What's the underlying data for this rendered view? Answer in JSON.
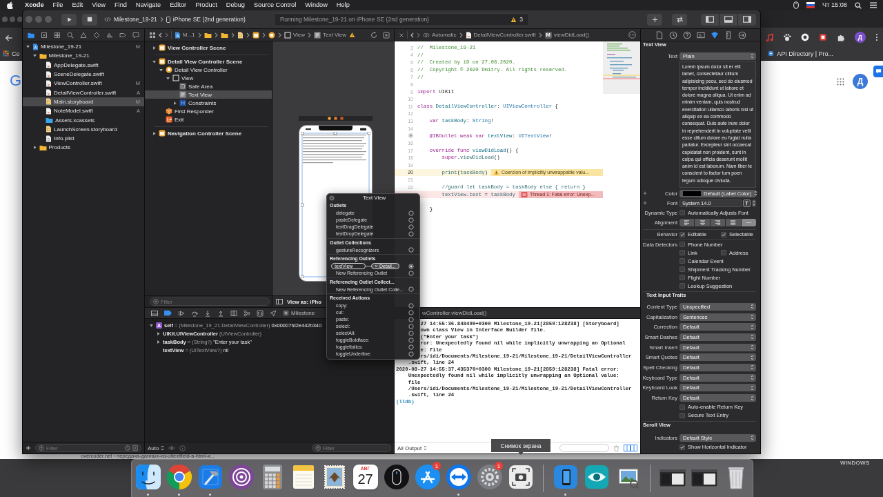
{
  "menu_bar": {
    "app": "Xcode",
    "menus": [
      "File",
      "Edit",
      "View",
      "Find",
      "Navigate",
      "Editor",
      "Product",
      "Debug",
      "Source Control",
      "Window",
      "Help"
    ],
    "clock": "Чт 15:08"
  },
  "browser": {
    "bookmark_left": "Ce",
    "bookmark": "API Directory | Pro...",
    "profile": "Д",
    "logo": "G",
    "account": "Д",
    "result_url": "overcoder.net › передача-данных-из-uitextfield-в-html-и..."
  },
  "desktop_label": "WINDOWS",
  "toolbar": {
    "scheme": "Milestone_19-21",
    "destination": "iPhone SE (2nd generation)",
    "activity": "Running Milestone_19-21 on iPhone SE (2nd generation)",
    "warning_count": "3"
  },
  "navigator": {
    "tabs": [
      {
        "kind": "project",
        "selected": true
      },
      {
        "kind": "source_control",
        "selected": false
      },
      {
        "kind": "symbols",
        "selected": false
      },
      {
        "kind": "find",
        "selected": false
      },
      {
        "kind": "issues",
        "selected": false
      },
      {
        "kind": "tests",
        "selected": false
      },
      {
        "kind": "debug",
        "selected": false
      },
      {
        "kind": "breakpoints",
        "selected": false
      },
      {
        "kind": "reports",
        "selected": false
      }
    ],
    "tree": [
      {
        "name": "Milestone_19-21",
        "kind": "project",
        "status": "M",
        "expanded": true,
        "selected": false,
        "children": [
          {
            "name": "Milestone_19-21",
            "kind": "folder",
            "expanded": true,
            "selected": false,
            "children": [
              {
                "name": "AppDelegate.swift",
                "kind": "swift",
                "selected": false
              },
              {
                "name": "SceneDelegate.swift",
                "kind": "swift",
                "selected": false
              },
              {
                "name": "ViewController.swift",
                "kind": "swift",
                "status": "M",
                "selected": false
              },
              {
                "name": "DetailViewController.swift",
                "kind": "swift",
                "status": "A",
                "selected": false
              },
              {
                "name": "Main.storyboard",
                "kind": "storyboard",
                "status": "M",
                "selected": true
              },
              {
                "name": "NoteModel.swift",
                "kind": "swift",
                "status": "A",
                "selected": false
              },
              {
                "name": "Assets.xcassets",
                "kind": "assets",
                "selected": false
              },
              {
                "name": "LaunchScreen.storyboard",
                "kind": "storyboard",
                "selected": false
              },
              {
                "name": "Info.plist",
                "kind": "plist",
                "selected": false
              }
            ]
          },
          {
            "name": "Products",
            "kind": "folder",
            "expanded": false,
            "selected": false
          }
        ]
      }
    ],
    "filter_placeholder": "Filter"
  },
  "storyboard_path": [
    "M...1",
    "View",
    "Text View"
  ],
  "outline": {
    "tree": [
      {
        "name": "View Controller Scene",
        "kind": "scene",
        "expanded": false,
        "selected": false
      },
      {
        "name": "Detail View Controller Scene",
        "kind": "scene",
        "expanded": true,
        "selected": false,
        "children": [
          {
            "name": "Detail View Controller",
            "kind": "controller",
            "expanded": true,
            "selected": false,
            "children": [
              {
                "name": "View",
                "kind": "view",
                "expanded": true,
                "selected": false,
                "children": [
                  {
                    "name": "Safe Area",
                    "kind": "safe_area",
                    "selected": false
                  },
                  {
                    "name": "Text View",
                    "kind": "text_view",
                    "selected": true
                  },
                  {
                    "name": "Constraints",
                    "kind": "constraints",
                    "expanded": false,
                    "selected": false
                  }
                ]
              }
            ]
          },
          {
            "name": "First Responder",
            "kind": "responder",
            "selected": false
          },
          {
            "name": "Exit",
            "kind": "exit",
            "selected": false
          }
        ]
      },
      {
        "name": "Navigation Controller Scene",
        "kind": "scene",
        "expanded": false,
        "selected": false
      }
    ],
    "filter_placeholder": "Filter"
  },
  "canvas": {
    "view_as": "View as: iPho"
  },
  "editor": {
    "jump_bar": {
      "mode": "Automatic",
      "file": "DetailViewController.swift",
      "symbol_badge": "M",
      "symbol": "viewDidLoad()"
    },
    "lines": [
      {
        "number": "3",
        "kind": "plain",
        "tokens": [
          {
            "kind": "comment",
            "text": "//  Milestone_19-21"
          }
        ]
      },
      {
        "number": "4",
        "kind": "plain",
        "tokens": [
          {
            "kind": "comment",
            "text": "//"
          }
        ]
      },
      {
        "number": "5",
        "kind": "plain",
        "tokens": [
          {
            "kind": "comment",
            "text": "//  Created by iD on 27.08.2020."
          }
        ]
      },
      {
        "number": "6",
        "kind": "plain",
        "tokens": [
          {
            "kind": "comment",
            "text": "//  Copyright © 2020 Dmitry. All rights reserved."
          }
        ]
      },
      {
        "number": "7",
        "kind": "plain",
        "tokens": [
          {
            "kind": "comment",
            "text": "//"
          }
        ]
      },
      {
        "number": "8",
        "kind": "plain"
      },
      {
        "number": "9",
        "kind": "plain",
        "tokens": [
          {
            "kind": "keyword",
            "text": "import"
          },
          {
            "kind": "plain",
            "text": " UIKit"
          }
        ]
      },
      {
        "number": "10",
        "kind": "plain"
      },
      {
        "number": "11",
        "kind": "plain",
        "tokens": [
          {
            "kind": "keyword",
            "text": "class"
          },
          {
            "kind": "declaration",
            "text": " DetailViewController"
          },
          {
            "kind": "plain",
            "text": ": "
          },
          {
            "kind": "type",
            "text": "UIViewController"
          },
          {
            "kind": "plain",
            "text": " {"
          }
        ]
      },
      {
        "number": "12",
        "kind": "plain"
      },
      {
        "number": "13",
        "kind": "plain",
        "tokens": [
          {
            "kind": "keyword",
            "text": "    var"
          },
          {
            "kind": "declaration",
            "text": " taskBody"
          },
          {
            "kind": "plain",
            "text": ": "
          },
          {
            "kind": "type",
            "text": "String"
          },
          {
            "kind": "plain",
            "text": "!"
          }
        ]
      },
      {
        "number": "14",
        "kind": "plain"
      },
      {
        "kind": "outlet",
        "tokens": [
          {
            "kind": "keyword",
            "text": "    @IBOutlet weak var"
          },
          {
            "kind": "declaration",
            "text": " textView"
          },
          {
            "kind": "plain",
            "text": ": "
          },
          {
            "kind": "type",
            "text": "UITextView"
          },
          {
            "kind": "plain",
            "text": "!"
          }
        ]
      },
      {
        "number": "16",
        "kind": "plain"
      },
      {
        "number": "17",
        "kind": "plain",
        "tokens": [
          {
            "kind": "keyword",
            "text": "    override func"
          },
          {
            "kind": "declaration",
            "text": " viewDidLoad"
          },
          {
            "kind": "plain",
            "text": "() {"
          }
        ]
      },
      {
        "number": "18",
        "kind": "plain",
        "tokens": [
          {
            "kind": "keyword",
            "text": "        super"
          },
          {
            "kind": "plain",
            "text": "."
          },
          {
            "kind": "call",
            "text": "viewDidLoad"
          },
          {
            "kind": "plain",
            "text": "()"
          }
        ]
      },
      {
        "number": "19",
        "kind": "plain"
      },
      {
        "number": "20",
        "kind": "warning",
        "tokens": [
          {
            "kind": "call",
            "text": "        print"
          },
          {
            "kind": "plain",
            "text": "("
          },
          {
            "kind": "call",
            "text": "taskBody"
          },
          {
            "kind": "plain",
            "text": ")"
          }
        ],
        "issue": "Coercion of implicitly unwrappable valu..."
      },
      {
        "number": "21",
        "kind": "plain"
      },
      {
        "number": "22",
        "kind": "plain",
        "tokens": [
          {
            "kind": "call",
            "text": "        //guard let taskBody = taskBody else { return }"
          }
        ]
      },
      {
        "kind": "error",
        "tokens": [
          {
            "kind": "call",
            "text": "        textView"
          },
          {
            "kind": "plain",
            "text": "."
          },
          {
            "kind": "call",
            "text": "text"
          },
          {
            "kind": "plain",
            "text": " = "
          },
          {
            "kind": "call",
            "text": "taskBody"
          }
        ],
        "issue": "Thread 1: Fatal error: Unexp..."
      },
      {
        "kind": "plain"
      },
      {
        "kind": "plain",
        "tokens": [
          {
            "kind": "plain",
            "text": "    }"
          }
        ]
      }
    ]
  },
  "connections": {
    "title": "Text View",
    "sections": [
      {
        "title": "Outlets",
        "rows": [
          {
            "kind": "slot",
            "name": "delegate",
            "connected": false
          },
          {
            "kind": "slot",
            "name": "pasteDelegate",
            "connected": false
          },
          {
            "kind": "slot",
            "name": "textDragDelegate",
            "connected": false
          },
          {
            "kind": "slot",
            "name": "textDropDelegate",
            "connected": false
          }
        ]
      },
      {
        "title": "Outlet Collections",
        "rows": [
          {
            "kind": "slot",
            "name": "gestureRecognizers",
            "connected": false
          }
        ]
      },
      {
        "title": "Referencing Outlets",
        "rows": [
          {
            "kind": "link",
            "name": "textView",
            "target": "Detail...",
            "connected": true
          },
          {
            "kind": "slot",
            "name": "New Referencing Outlet",
            "connected": false
          }
        ]
      },
      {
        "title": "Referencing Outlet Collect...",
        "rows": [
          {
            "kind": "slot",
            "name": "New Referencing Outlet Colle...",
            "connected": false
          }
        ]
      },
      {
        "title": "Received Actions",
        "rows": [
          {
            "kind": "slot",
            "name": "copy:",
            "connected": false
          },
          {
            "kind": "slot",
            "name": "cut:",
            "connected": false
          },
          {
            "kind": "slot",
            "name": "paste:",
            "connected": false
          },
          {
            "kind": "slot",
            "name": "select:",
            "connected": false
          },
          {
            "kind": "slot",
            "name": "selectAll:",
            "connected": false
          },
          {
            "kind": "slot",
            "name": "toggleBoldface:",
            "connected": false
          },
          {
            "kind": "slot",
            "name": "toggleItalics:",
            "connected": false
          },
          {
            "kind": "slot",
            "name": "toggleUnderline:",
            "connected": false
          }
        ]
      }
    ]
  },
  "debug_bar": {
    "breakpoints_on": true,
    "process": "Milestone",
    "frame": "wController.viewDidLoad()"
  },
  "variables": [
    {
      "badge": "A",
      "name": "self",
      "type": "= (Milestone_19_21.DetailViewController)",
      "value": "0x00007fd2e442b340",
      "expanded": true,
      "children": [
        {
          "name": "UIKit.UIViewController",
          "type": "(UIViewController)",
          "expanded": false
        },
        {
          "name": "taskBody",
          "type": "= (String?)",
          "value": "\"Enter your task\"",
          "expanded": false
        },
        {
          "name": "textView",
          "type": "= (UITextView?)",
          "value": "nil"
        }
      ]
    }
  ],
  "variables_footer": {
    "scope": "Auto",
    "filter_placeholder": "Filter"
  },
  "console": [
    {
      "kind": "clipped",
      "text": "27 14:55:36.848499+0300 Milestone_19-21[2859:128238] [Storyboard]"
    },
    {
      "kind": "clipped",
      "text": "own class View in Interface Builder file."
    },
    {
      "kind": "clipped",
      "text": "(\"Enter your task\")"
    },
    {
      "kind": "clipped",
      "text": "ror: Unexpectedly found nil while implicitly unwrapping an Optional"
    },
    {
      "kind": "clipped",
      "text": "e: file"
    },
    {
      "kind": "clipped",
      "text": "rs/idi/Documents/Milestone_19-21/Milestone_19-21/DetailViewController"
    },
    {
      "kind": "output",
      "text": "    .swift, line 24"
    },
    {
      "kind": "output",
      "text": "2020-08-27 14:55:37.435370+0300 Milestone_19-21[2859:128238] Fatal error:"
    },
    {
      "kind": "output",
      "text": "    Unexpectedly found nil while implicitly unwrapping an Optional value:"
    },
    {
      "kind": "output",
      "text": "    file"
    },
    {
      "kind": "output",
      "text": "    /Users/idi/Documents/Milestone_19-21/Milestone_19-21/DetailViewController"
    },
    {
      "kind": "output",
      "text": "    .swift, line 24"
    },
    {
      "kind": "prompt",
      "text": "(lldb)"
    }
  ],
  "console_footer": {
    "output": "All Output"
  },
  "inspector": {
    "tabs": [
      {
        "kind": "file",
        "selected": false
      },
      {
        "kind": "history",
        "selected": false
      },
      {
        "kind": "help",
        "selected": false
      },
      {
        "kind": "identity",
        "selected": false
      },
      {
        "kind": "attributes",
        "selected": true
      },
      {
        "kind": "size",
        "selected": false
      },
      {
        "kind": "connections",
        "selected": false
      }
    ],
    "title": "Text View",
    "text_type": {
      "label": "Text",
      "value": "Plain"
    },
    "text": "Lorem ipsum dolor sit er elit lamet, consectetaur cillium adipisicing pecu, sed do eiusmod tempor incididunt ut labore et dolore magna aliqua. Ut enim ad minim veniam, quis nostrud exercitation ullamco laboris nisi ut aliquip ex ea commodo consequat. Duis aute irure dolor in reprehenderit in voluptate velit esse cillum dolore eu fugiat nulla pariatur. Excepteur sint occaecat cupidatat non proident, sunt in culpa qui officia deserunt mollit anim id est laborum. Nam liber te conscient to factor tum poen legum odioque civiuda.",
    "color": {
      "label": "Color",
      "value": "Default (Label Color)"
    },
    "font": {
      "label": "Font",
      "value": "System 14.0"
    },
    "dynamic_type": {
      "label": "Dynamic Type",
      "option": "Automatically Adjusts Font",
      "checked": false
    },
    "alignment": {
      "label": "Alignment",
      "segments": [
        {
          "kind": "left",
          "selected": false
        },
        {
          "kind": "center",
          "selected": false
        },
        {
          "kind": "right",
          "selected": false
        },
        {
          "kind": "justified",
          "selected": false
        },
        {
          "kind": "natural",
          "selected": true
        }
      ]
    },
    "behavior": {
      "label": "Behavior",
      "options": [
        {
          "label": "Editable",
          "checked": true
        },
        {
          "label": "Selectable",
          "checked": true
        }
      ]
    },
    "data_detectors": {
      "label": "Data Detectors",
      "rows": [
        {
          "options": [
            {
              "label": "Phone Number",
              "checked": false
            }
          ]
        },
        {
          "options": [
            {
              "label": "Link",
              "checked": false
            },
            {
              "label": "Address",
              "checked": false
            }
          ]
        },
        {
          "options": [
            {
              "label": "Calendar Event",
              "checked": false
            }
          ]
        },
        {
          "options": [
            {
              "label": "Shipment Tracking Number",
              "checked": false
            }
          ]
        },
        {
          "options": [
            {
              "label": "Flight Number",
              "checked": false
            }
          ]
        },
        {
          "options": [
            {
              "label": "Lookup Suggestion",
              "checked": false
            }
          ]
        }
      ]
    },
    "input_traits": {
      "title": "Text Input Traits",
      "fields": [
        {
          "label": "Content Type",
          "value": "Unspecified"
        },
        {
          "label": "Capitalization",
          "value": "Sentences"
        },
        {
          "label": "Correction",
          "value": "Default"
        },
        {
          "label": "Smart Dashes",
          "value": "Default"
        },
        {
          "label": "Smart Insert",
          "value": "Default"
        },
        {
          "label": "Smart Quotes",
          "value": "Default"
        },
        {
          "label": "Spell Checking",
          "value": "Default"
        },
        {
          "label": "Keyboard Type",
          "value": "Default"
        },
        {
          "label": "Keyboard Look",
          "value": "Default"
        },
        {
          "label": "Return Key",
          "value": "Default"
        }
      ],
      "options": [
        {
          "label": "Auto-enable Return Key",
          "checked": false
        },
        {
          "label": "Secure Text Entry",
          "checked": false
        }
      ]
    },
    "scroll_view": {
      "title": "Scroll View",
      "fields": [
        {
          "label": "Indicators",
          "value": "Default Style"
        }
      ],
      "options": [
        {
          "label": "Show Horizontal Indicator",
          "checked": true
        }
      ]
    }
  },
  "dock": [
    {
      "kind": "finder",
      "running": true
    },
    {
      "kind": "chrome",
      "running": true
    },
    {
      "kind": "xcode",
      "running": true
    },
    {
      "kind": "tor",
      "running": false
    },
    {
      "kind": "calculator",
      "running": false
    },
    {
      "kind": "notes",
      "running": false
    },
    {
      "kind": "mail",
      "running": false
    },
    {
      "kind": "calendar",
      "month": "АВГ",
      "day": "27",
      "running": false
    },
    {
      "kind": "mouse",
      "running": false
    },
    {
      "kind": "app_store",
      "badge": "1",
      "running": false
    },
    {
      "kind": "teamviewer",
      "running": true
    },
    {
      "kind": "settings",
      "badge": "1",
      "running": false
    },
    {
      "kind": "screenshot",
      "running": false
    },
    {
      "kind": "separator"
    },
    {
      "kind": "simulator",
      "running": true
    },
    {
      "kind": "eye",
      "running": false
    },
    {
      "kind": "preview",
      "running": false
    },
    {
      "kind": "separator"
    },
    {
      "kind": "window"
    },
    {
      "kind": "window"
    },
    {
      "kind": "trash"
    }
  ],
  "tooltip": "Снимок экрана"
}
